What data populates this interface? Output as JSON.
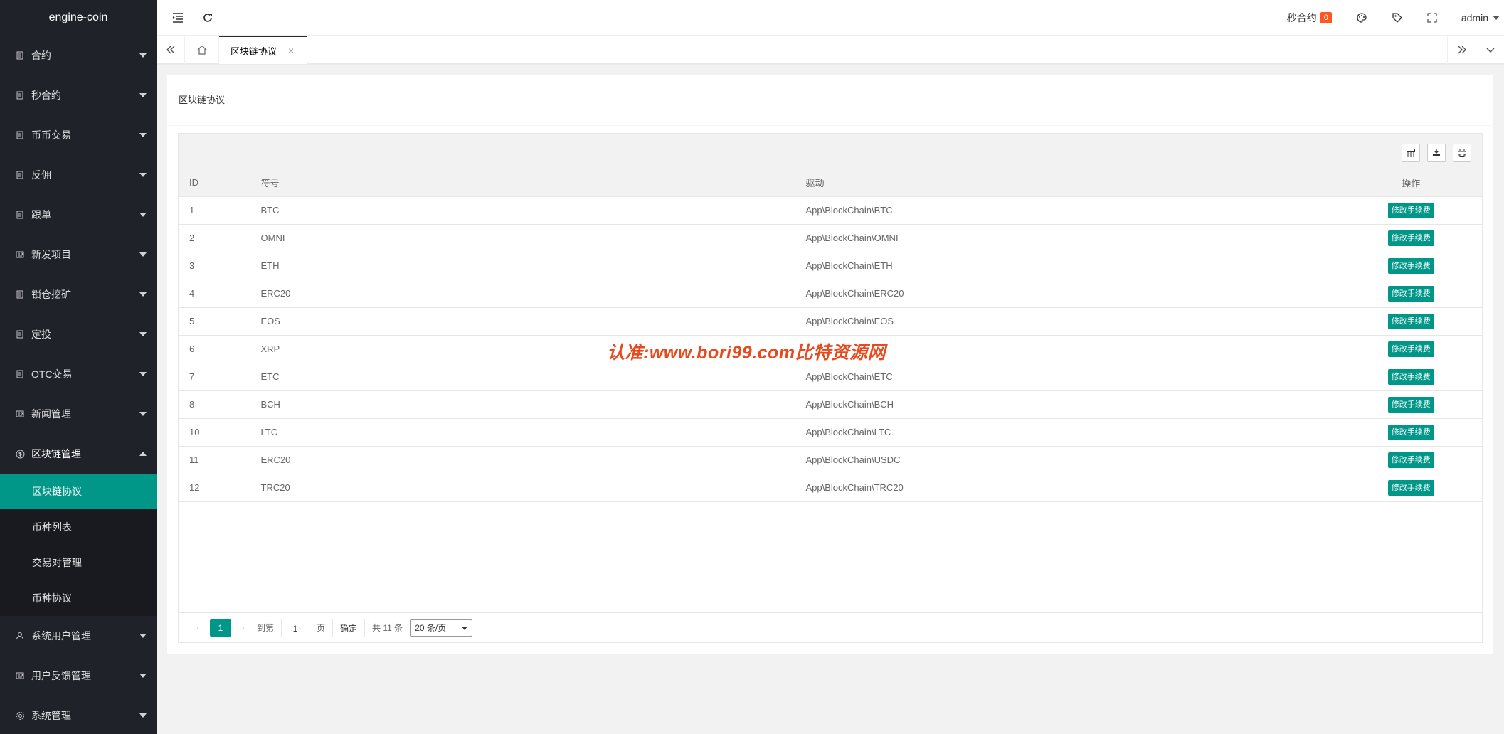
{
  "app": {
    "title": "engine-coin"
  },
  "sidebar": {
    "items": [
      {
        "label": "合约"
      },
      {
        "label": "秒合约"
      },
      {
        "label": "币币交易"
      },
      {
        "label": "反佣"
      },
      {
        "label": "跟单"
      },
      {
        "label": "新发项目"
      },
      {
        "label": "锁仓挖矿"
      },
      {
        "label": "定投"
      },
      {
        "label": "OTC交易"
      },
      {
        "label": "新闻管理"
      },
      {
        "label": "区块链管理"
      },
      {
        "label": "系统用户管理"
      },
      {
        "label": "用户反馈管理"
      },
      {
        "label": "系统管理"
      }
    ],
    "sub_items": [
      {
        "label": "区块链协议"
      },
      {
        "label": "币种列表"
      },
      {
        "label": "交易对管理"
      },
      {
        "label": "币种协议"
      }
    ]
  },
  "header": {
    "second_contract_label": "秒合约",
    "badge_count": "0",
    "user": "admin"
  },
  "tabs": {
    "active_label": "区块链协议",
    "close": "×"
  },
  "page": {
    "title": "区块链协议"
  },
  "table": {
    "columns": [
      "ID",
      "符号",
      "驱动",
      "操作"
    ],
    "action_label": "修改手续费",
    "rows": [
      {
        "id": "1",
        "symbol": "BTC",
        "driver": "App\\BlockChain\\BTC"
      },
      {
        "id": "2",
        "symbol": "OMNI",
        "driver": "App\\BlockChain\\OMNI"
      },
      {
        "id": "3",
        "symbol": "ETH",
        "driver": "App\\BlockChain\\ETH"
      },
      {
        "id": "4",
        "symbol": "ERC20",
        "driver": "App\\BlockChain\\ERC20"
      },
      {
        "id": "5",
        "symbol": "EOS",
        "driver": "App\\BlockChain\\EOS"
      },
      {
        "id": "6",
        "symbol": "XRP",
        "driver": ""
      },
      {
        "id": "7",
        "symbol": "ETC",
        "driver": "App\\BlockChain\\ETC"
      },
      {
        "id": "8",
        "symbol": "BCH",
        "driver": "App\\BlockChain\\BCH"
      },
      {
        "id": "10",
        "symbol": "LTC",
        "driver": "App\\BlockChain\\LTC"
      },
      {
        "id": "11",
        "symbol": "ERC20",
        "driver": "App\\BlockChain\\USDC"
      },
      {
        "id": "12",
        "symbol": "TRC20",
        "driver": "App\\BlockChain\\TRC20"
      }
    ]
  },
  "pagination": {
    "current": "1",
    "goto_label": "到第",
    "page_input": "1",
    "page_unit": "页",
    "confirm": "确定",
    "total": "共 11 条",
    "per_page": "20 条/页"
  },
  "watermark": "认准:www.bori99.com比特资源网",
  "colors": {
    "accent": "#009688",
    "sidebar_bg": "#20222a",
    "badge": "#ff5722",
    "watermark": "#e8491d"
  }
}
